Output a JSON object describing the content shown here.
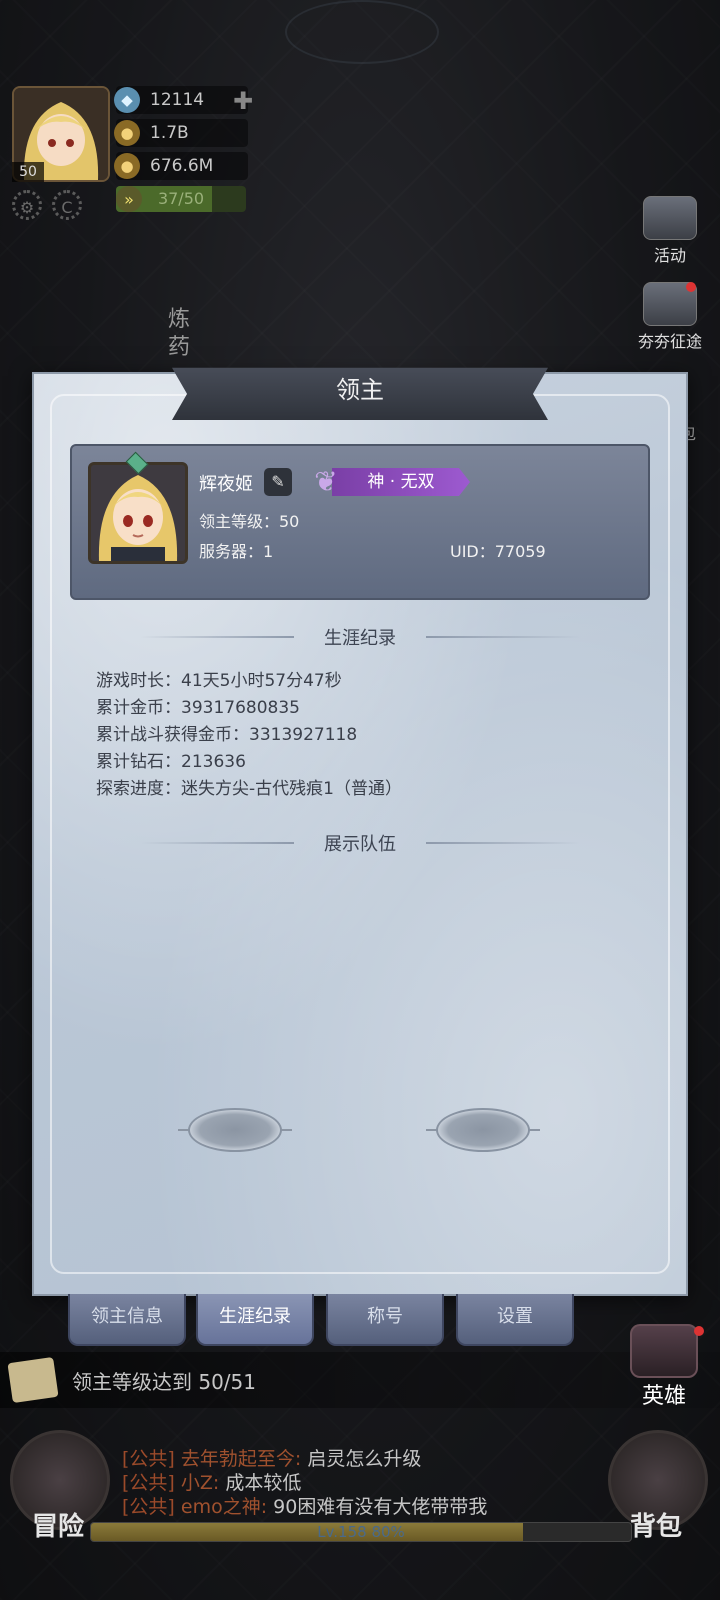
{
  "hud": {
    "player_level": "50",
    "diamonds": "12114",
    "gold": "1.7B",
    "gold2": "676.6M",
    "energy": "37/50",
    "energy_fraction": 0.74
  },
  "side": {
    "activity_label": "活动",
    "expedition_label": "夯夯征途",
    "alchemy_label": "炼药",
    "bag_partial": "包"
  },
  "panel": {
    "title": "领主",
    "lord_name": "辉夜姬",
    "title_badge": "神 · 无双",
    "level_label": "领主等级：50",
    "server_label": "服务器：1",
    "uid_label": "UID：77059",
    "career_header": "生涯纪录",
    "stats": [
      "游戏时长：41天5小时57分47秒",
      "累计金币：39317680835",
      "累计战斗获得金币：3313927118",
      "累计钻石：213636",
      "探索进度：迷失方尖-古代残痕1（普通）"
    ],
    "team_header": "展示队伍"
  },
  "tabs": [
    {
      "label": "领主信息",
      "active": false
    },
    {
      "label": "生涯纪录",
      "active": true
    },
    {
      "label": "称号",
      "active": false
    },
    {
      "label": "设置",
      "active": false
    }
  ],
  "bottom": {
    "quest": "领主等级达到 50/51",
    "hero": "英雄",
    "adventure": "冒险",
    "bag": "背包",
    "chat": [
      {
        "channel": "[公共]",
        "user": "去年勃起至今:",
        "msg": " 启灵怎么升级"
      },
      {
        "channel": "[公共]",
        "user": "小Z:",
        "msg": " 成本较低"
      },
      {
        "channel": "[公共]",
        "user": "emo之神:",
        "msg": " 90困难有没有大佬带带我"
      }
    ],
    "xp_label": "Lv.158  80%",
    "xp_fraction": 0.8
  }
}
